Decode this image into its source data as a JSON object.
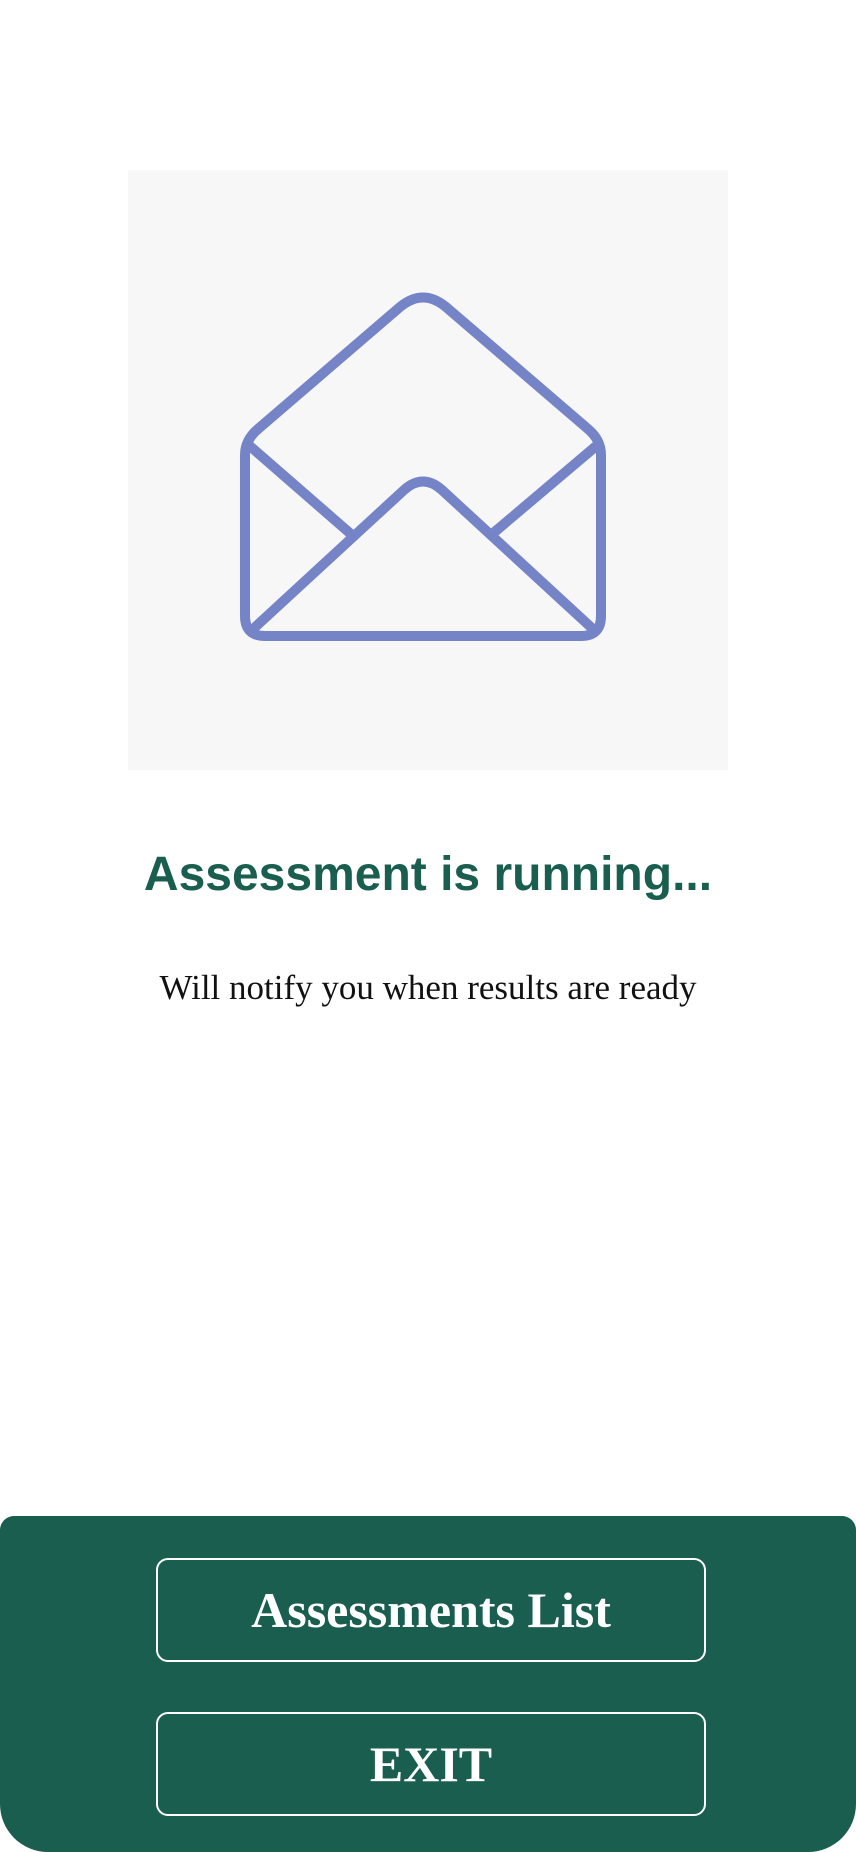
{
  "illustration": {
    "icon": "open-envelope-icon",
    "icon_color": "#7584c6",
    "background_color": "#f7f7f8"
  },
  "status": {
    "title": "Assessment is running...",
    "message": "Will notify you when results are ready"
  },
  "footer": {
    "background_color": "#195e4e",
    "assessments_list_label": "Assessments List",
    "exit_label": "EXIT"
  }
}
